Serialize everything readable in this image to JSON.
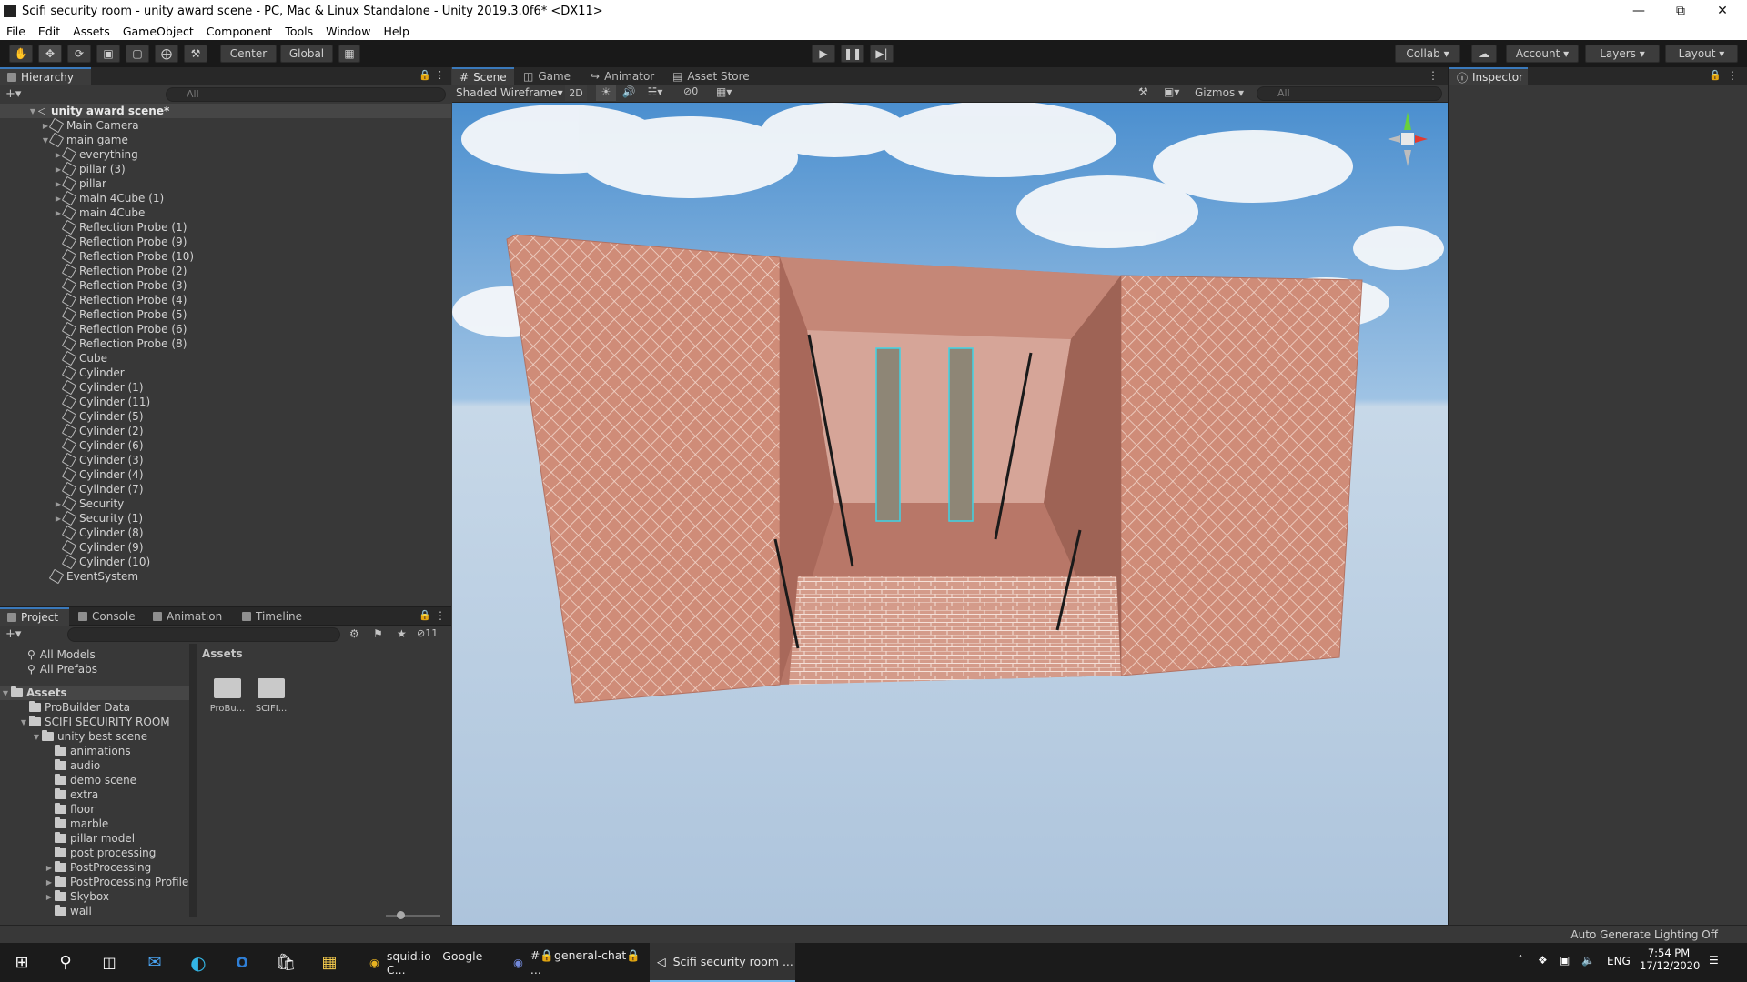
{
  "window": {
    "title": "Scifi security room - unity award scene - PC, Mac & Linux Standalone - Unity 2019.3.0f6* <DX11>",
    "controls": [
      "—",
      "⧉",
      "✕"
    ]
  },
  "menu": [
    "File",
    "Edit",
    "Assets",
    "GameObject",
    "Component",
    "Tools",
    "Window",
    "Help"
  ],
  "toolbar": {
    "pivot": "Center",
    "space": "Global",
    "collab": "Collab",
    "account": "Account",
    "layers": "Layers",
    "layout": "Layout"
  },
  "hierarchy": {
    "tab": "Hierarchy",
    "search_placeholder": "All",
    "scene_name": "unity award scene*",
    "items": [
      {
        "label": "Main Camera",
        "depth": 1,
        "expandable": true
      },
      {
        "label": "main game",
        "depth": 1,
        "expandable": true,
        "expanded": true
      },
      {
        "label": "everything",
        "depth": 2,
        "expandable": true
      },
      {
        "label": "pillar (3)",
        "depth": 2,
        "expandable": true
      },
      {
        "label": "pillar",
        "depth": 2,
        "expandable": true
      },
      {
        "label": "main 4Cube (1)",
        "depth": 2,
        "expandable": true
      },
      {
        "label": "main 4Cube",
        "depth": 2,
        "expandable": true
      },
      {
        "label": "Reflection Probe (1)",
        "depth": 2
      },
      {
        "label": "Reflection Probe (9)",
        "depth": 2
      },
      {
        "label": "Reflection Probe (10)",
        "depth": 2
      },
      {
        "label": "Reflection Probe (2)",
        "depth": 2
      },
      {
        "label": "Reflection Probe (3)",
        "depth": 2
      },
      {
        "label": "Reflection Probe (4)",
        "depth": 2
      },
      {
        "label": "Reflection Probe (5)",
        "depth": 2
      },
      {
        "label": "Reflection Probe (6)",
        "depth": 2
      },
      {
        "label": "Reflection Probe (8)",
        "depth": 2
      },
      {
        "label": "Cube",
        "depth": 2
      },
      {
        "label": "Cylinder",
        "depth": 2
      },
      {
        "label": "Cylinder (1)",
        "depth": 2
      },
      {
        "label": "Cylinder (11)",
        "depth": 2
      },
      {
        "label": "Cylinder (5)",
        "depth": 2
      },
      {
        "label": "Cylinder (2)",
        "depth": 2
      },
      {
        "label": "Cylinder (6)",
        "depth": 2
      },
      {
        "label": "Cylinder (3)",
        "depth": 2
      },
      {
        "label": "Cylinder (4)",
        "depth": 2
      },
      {
        "label": "Cylinder (7)",
        "depth": 2
      },
      {
        "label": "Security",
        "depth": 2,
        "expandable": true
      },
      {
        "label": "Security (1)",
        "depth": 2,
        "expandable": true
      },
      {
        "label": "Cylinder (8)",
        "depth": 2
      },
      {
        "label": "Cylinder (9)",
        "depth": 2
      },
      {
        "label": "Cylinder (10)",
        "depth": 2
      },
      {
        "label": "EventSystem",
        "depth": 1
      }
    ]
  },
  "center_tabs": [
    "Scene",
    "Game",
    "Animator",
    "Asset Store"
  ],
  "scene_toolbar": {
    "draw_mode": "Shaded Wireframe",
    "mode_2d": "2D",
    "hidden_count": "0",
    "gizmos": "Gizmos",
    "search_placeholder": "All"
  },
  "inspector": {
    "tab": "Inspector"
  },
  "project": {
    "tabs": [
      "Project",
      "Console",
      "Animation",
      "Timeline"
    ],
    "hidden_count": "11",
    "favorites": [
      "All Models",
      "All Prefabs"
    ],
    "tree": [
      {
        "label": "Assets",
        "depth": 0,
        "expandable": true,
        "bold": true
      },
      {
        "label": "ProBuilder Data",
        "depth": 1
      },
      {
        "label": "SCIFI SECUIRITY ROOM",
        "depth": 1,
        "expandable": true
      },
      {
        "label": "unity best scene",
        "depth": 2,
        "expandable": true
      },
      {
        "label": "animations",
        "depth": 3
      },
      {
        "label": "audio",
        "depth": 3
      },
      {
        "label": "demo scene",
        "depth": 3
      },
      {
        "label": "extra",
        "depth": 3
      },
      {
        "label": "floor",
        "depth": 3
      },
      {
        "label": "marble",
        "depth": 3
      },
      {
        "label": "pillar model",
        "depth": 3
      },
      {
        "label": "post processing",
        "depth": 3
      },
      {
        "label": "PostProcessing",
        "depth": 3,
        "expandable": true
      },
      {
        "label": "PostProcessing Profile",
        "depth": 3,
        "expandable": true
      },
      {
        "label": "Skybox",
        "depth": 3,
        "expandable": true
      },
      {
        "label": "wall",
        "depth": 3
      }
    ],
    "assets_header": "Assets",
    "asset_items": [
      "ProBu...",
      "SCIFI..."
    ]
  },
  "status": {
    "right": "Auto Generate Lighting Off"
  },
  "taskbar": {
    "apps": [
      "squid.io - Google C...",
      "#🔒general-chat🔒 ...",
      "Scifi security room ..."
    ],
    "lang": "ENG",
    "time": "7:54 PM",
    "date": "17/12/2020"
  },
  "colors": {
    "accent": "#3a79bb",
    "panel": "#383838",
    "toolbar": "#191919",
    "wall": "#c9826c",
    "taskbar": "#1b1b1b"
  }
}
